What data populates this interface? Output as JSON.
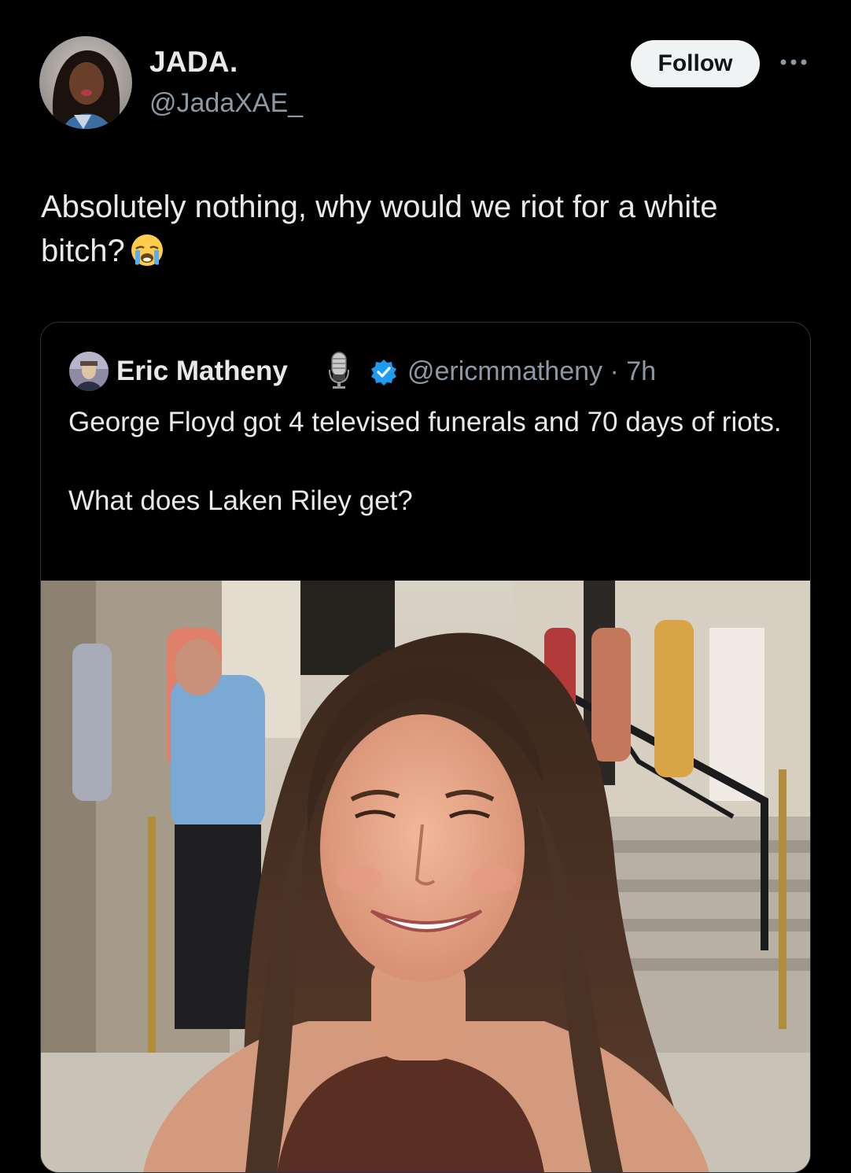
{
  "tweet": {
    "author": {
      "name": "JADA.",
      "handle": "@JadaXAE_",
      "avatar_icon": "profile-photo-avatar"
    },
    "follow_label": "Follow",
    "more_icon": "more-horizontal-icon",
    "text": "Absolutely nothing, why would we riot for a white bitch?",
    "emoji": "loudly-crying-face"
  },
  "quote": {
    "author": {
      "name": "Eric Matheny",
      "badge_icon": "microphone-icon",
      "verified_icon": "verified-badge-icon",
      "handle_time": "@ericmmatheny · 7h"
    },
    "text_paragraph_1": "George Floyd got 4 televised funerals and 70 days of riots.",
    "text_paragraph_2": "What does Laken Riley get?",
    "media": "photo-woman-smiling-outdoors"
  },
  "colors": {
    "background": "#000000",
    "text_primary": "#e7e9ea",
    "text_secondary": "#8b98a5",
    "border": "#2f3336",
    "follow_bg": "#eff3f4",
    "verified": "#1d9bf0"
  }
}
